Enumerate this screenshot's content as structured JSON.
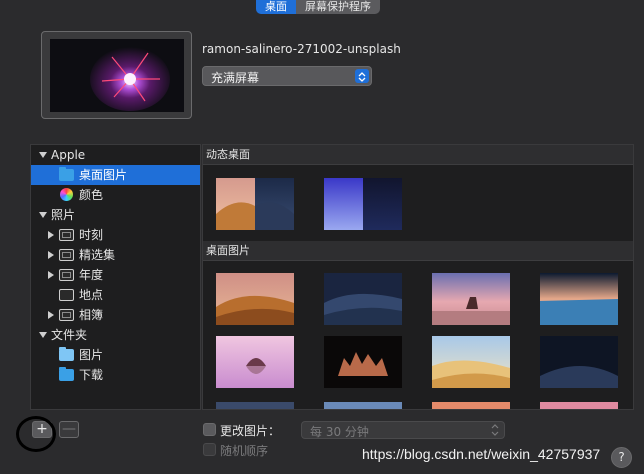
{
  "tabs": [
    {
      "label": "桌面",
      "active": true
    },
    {
      "label": "屏幕保护程序",
      "active": false
    }
  ],
  "preview": {
    "name": "ramon-salinero-271002-unsplash"
  },
  "fit_popup": {
    "value": "充满屏幕"
  },
  "sidebar": {
    "apple": {
      "label": "Apple",
      "items": [
        {
          "label": "桌面图片",
          "selected": true,
          "icon": "folder-icon"
        },
        {
          "label": "颜色",
          "icon": "color-wheel-icon"
        }
      ]
    },
    "photos": {
      "label": "照片",
      "items": [
        {
          "label": "时刻"
        },
        {
          "label": "精选集"
        },
        {
          "label": "年度"
        },
        {
          "label": "地点"
        },
        {
          "label": "相簿"
        }
      ]
    },
    "folders": {
      "label": "文件夹",
      "items": [
        {
          "label": "图片",
          "icon": "pictures-folder-icon"
        },
        {
          "label": "下载",
          "icon": "downloads-folder-icon"
        }
      ]
    }
  },
  "sections": {
    "dynamic": "动态桌面",
    "desktop_pictures": "桌面图片"
  },
  "bottom": {
    "add_label": "+",
    "remove_label": "—",
    "change_picture_label": "更改图片：",
    "interval_value": "每 30 分钟",
    "random_order_label": "随机顺序",
    "help_label": "?"
  },
  "watermark": "https://blog.csdn.net/weixin_42757937",
  "colors": {
    "accent": "#1f6fd8",
    "background": "#2b2b2d",
    "panel": "#1e1e1f"
  }
}
